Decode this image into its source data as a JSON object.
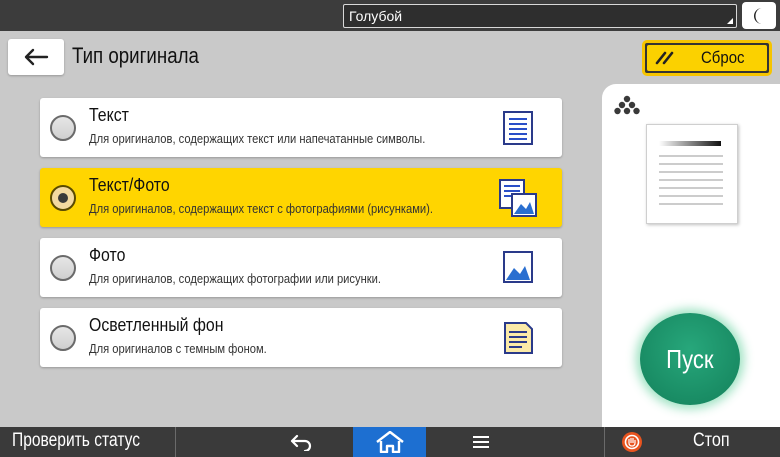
{
  "topbar": {
    "user_selected": "Голубой",
    "energy_icon": "moon-icon"
  },
  "header": {
    "back_icon": "arrow-left-icon",
    "title": "Тип оригинала",
    "reset_label": "Сброс",
    "reset_icon": "double-slash-icon"
  },
  "options": [
    {
      "title": "Текст",
      "description": "Для оригиналов, содержащих текст или напечатанные символы.",
      "selected": false,
      "icon": "text-document-icon"
    },
    {
      "title": "Текст/Фото",
      "description": "Для оригиналов, содержащих текст с фотографиями (рисунками).",
      "selected": true,
      "icon": "text-photo-document-icon"
    },
    {
      "title": "Фото",
      "description": "Для оригиналов, содержащих фотографии или рисунки.",
      "selected": false,
      "icon": "photo-icon"
    },
    {
      "title": "Осветленный фон",
      "description": "Для оригиналов с темным фоном.",
      "selected": false,
      "icon": "light-background-document-icon"
    }
  ],
  "preview": {
    "tone_icon": "toner-dots-icon",
    "thumbnail_icon": "page-preview-icon"
  },
  "start_label": "Пуск",
  "bottombar": {
    "status_label": "Проверить статус",
    "back_icon": "return-arrow-icon",
    "home_icon": "home-icon",
    "menu_icon": "menu-icon",
    "stop_icon": "stop-hand-icon",
    "stop_label": "Стоп"
  },
  "colors": {
    "accent_yellow": "#ffd500",
    "start_green": "#1a8f65",
    "home_blue": "#1d6fd1",
    "stop_orange": "#e8541f"
  }
}
